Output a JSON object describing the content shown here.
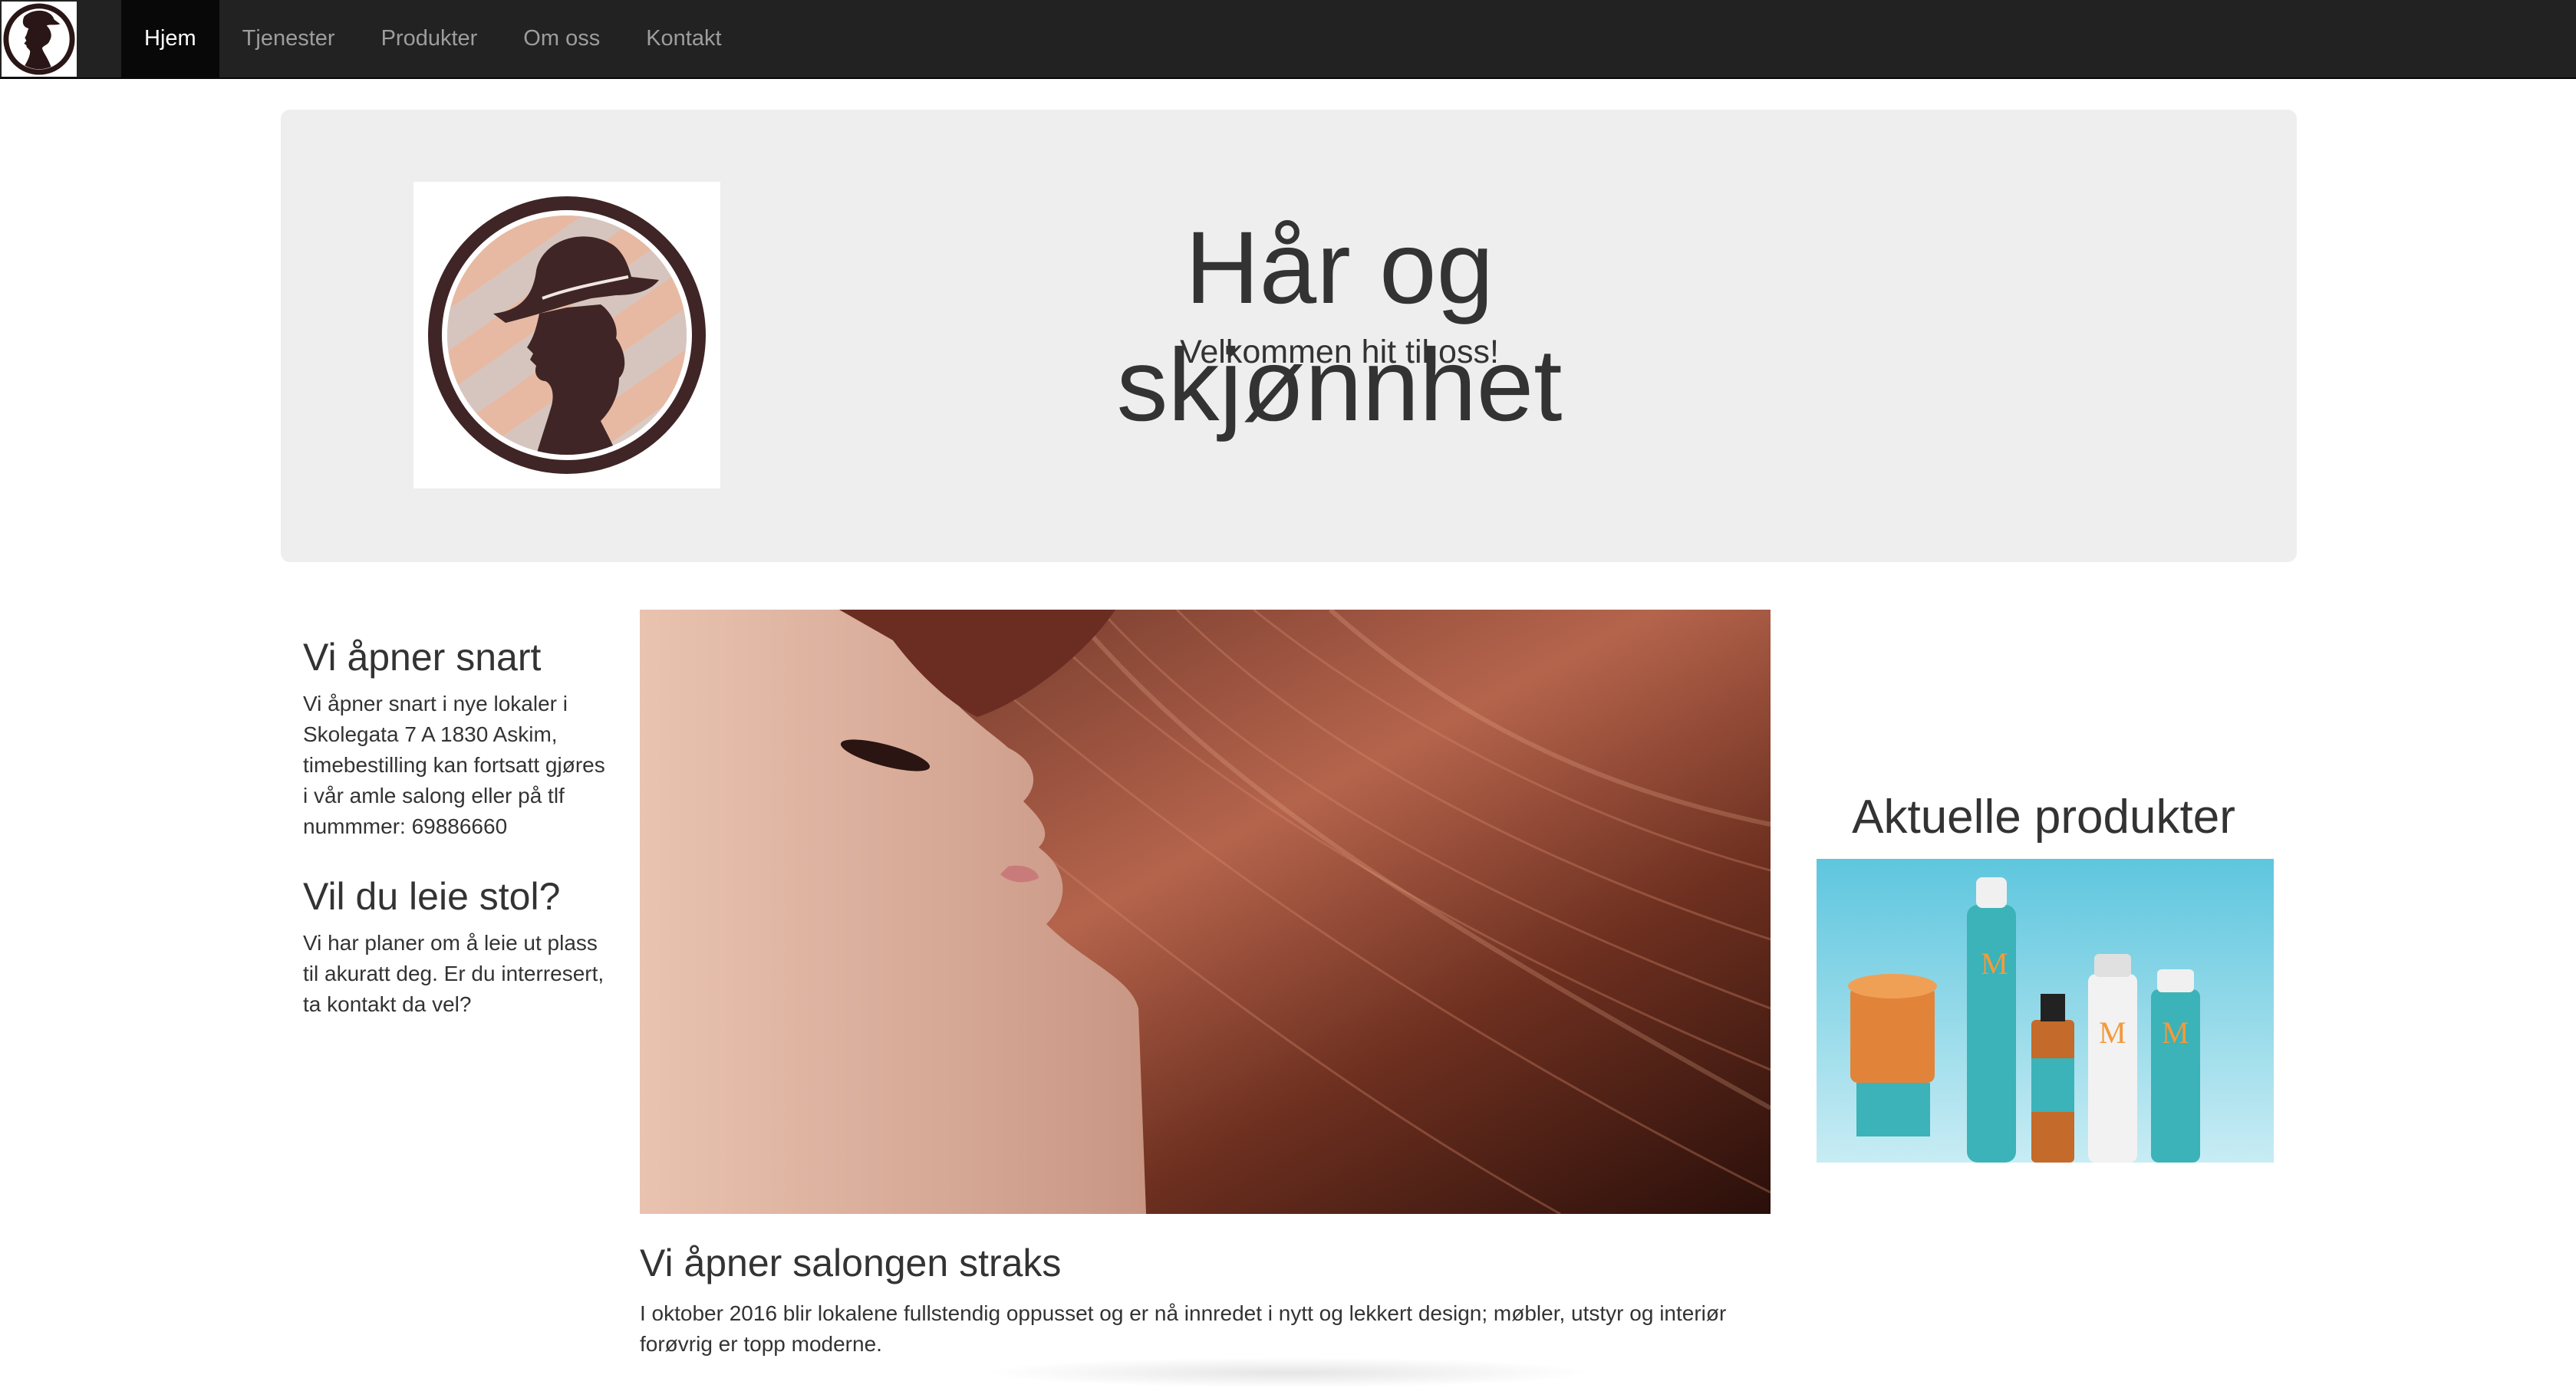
{
  "nav": {
    "brand_alt": "Hår og skjønnhet logo",
    "items": [
      {
        "label": "Hjem",
        "active": true
      },
      {
        "label": "Tjenester",
        "active": false
      },
      {
        "label": "Produkter",
        "active": false
      },
      {
        "label": "Om oss",
        "active": false
      },
      {
        "label": "Kontakt",
        "active": false
      }
    ]
  },
  "jumbotron": {
    "title": "Hår og skjønnhet",
    "subtitle": "Velkommen hit til oss!"
  },
  "sidebar": {
    "sections": [
      {
        "heading": "Vi åpner snart",
        "text": "Vi åpner snart i nye lokaler i Skolegata 7 A 1830 Askim, timebestilling kan fortsatt gjøres i vår amle salong eller på tlf nummmer: 69886660"
      },
      {
        "heading": "Vil du leie stol?",
        "text": "Vi har planer om å leie ut plass til akuratt deg. Er du interresert, ta kontakt da vel?"
      }
    ]
  },
  "main": {
    "image_subject": "woman with long auburn hair",
    "article_title": "Vi åpner salongen straks",
    "article_text": "I oktober 2016 blir lokalene fullstendig oppusset og er nå innredet i nytt og lekkert design; møbler, utstyr og interiør forøvrig er topp moderne."
  },
  "products": {
    "title": "Aktuelle produkter",
    "image_subject": "Moroccanoil hair care products"
  },
  "colors": {
    "navbar": "#222222",
    "nav_active": "#080808",
    "jumbotron": "#eeeeee",
    "logo_brown": "#4a2a2a",
    "logo_peach": "#e8b9a2",
    "product_teal": "#3bb3b8"
  }
}
